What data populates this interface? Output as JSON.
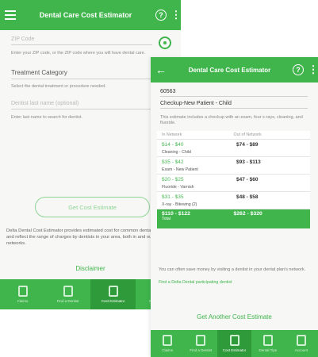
{
  "back_screen": {
    "title": "Dental Care Cost Estimator",
    "zip_placeholder": "ZIP Code",
    "zip_hint": "Enter your ZIP code, or the ZIP code where you will have dental care.",
    "treatment_label": "Treatment Category",
    "treatment_hint": "Select the dental treatment or procedure needed.",
    "dentist_placeholder": "Dentist last name (optional)",
    "dentist_hint": "Enter last name to search for dentist.",
    "estimate_button": "Get Cost Estimate",
    "description": "Delta Dental Cost Estimator provides estimated cost for common dental care needs and reflect the range of charges by dentists in your area, both in and out of our networks.",
    "disclaimer": "Disclaimer"
  },
  "front_screen": {
    "title": "Dental Care Cost Estimator",
    "zip_value": "60563",
    "treatment_value": "Checkup-New Patient - Child",
    "treatment_desc": "This estimate includes a checkup with an exam, four x-rays, cleaning, and fluoride.",
    "table": {
      "headers": [
        "In Network",
        "Out of Network"
      ],
      "rows": [
        {
          "in": "$14 - $40",
          "out": "$74 - $89",
          "procedure": "Cleaning - Child"
        },
        {
          "in": "$35 - $42",
          "out": "$93 - $113",
          "procedure": "Exam - New Patient"
        },
        {
          "in": "$20 - $25",
          "out": "$47 - $60",
          "procedure": "Fluoride - Varnish"
        },
        {
          "in": "$31 - $35",
          "out": "$48 - $58",
          "procedure": "X-ray - Bitewing (2)"
        }
      ],
      "total_in": "$110 - $122",
      "total_out": "$262 - $320",
      "total_label": "Total"
    },
    "save_text": "You can often save money by visiting a dentist in your dental plan's network.",
    "find_link": "Find a Delta Dental participating dentist",
    "another_button": "Get Another Cost Estimate"
  },
  "nav_items": [
    "Claims",
    "Find a Dentist",
    "Cost Estimator",
    "Dental Tips",
    "Account"
  ],
  "colors": {
    "brand_green": "#3fb54c",
    "active_nav": "#2e9a3a"
  },
  "icons": [
    "menu-icon",
    "help-icon",
    "more-icon",
    "back-icon",
    "locate-icon",
    "search-icon"
  ]
}
